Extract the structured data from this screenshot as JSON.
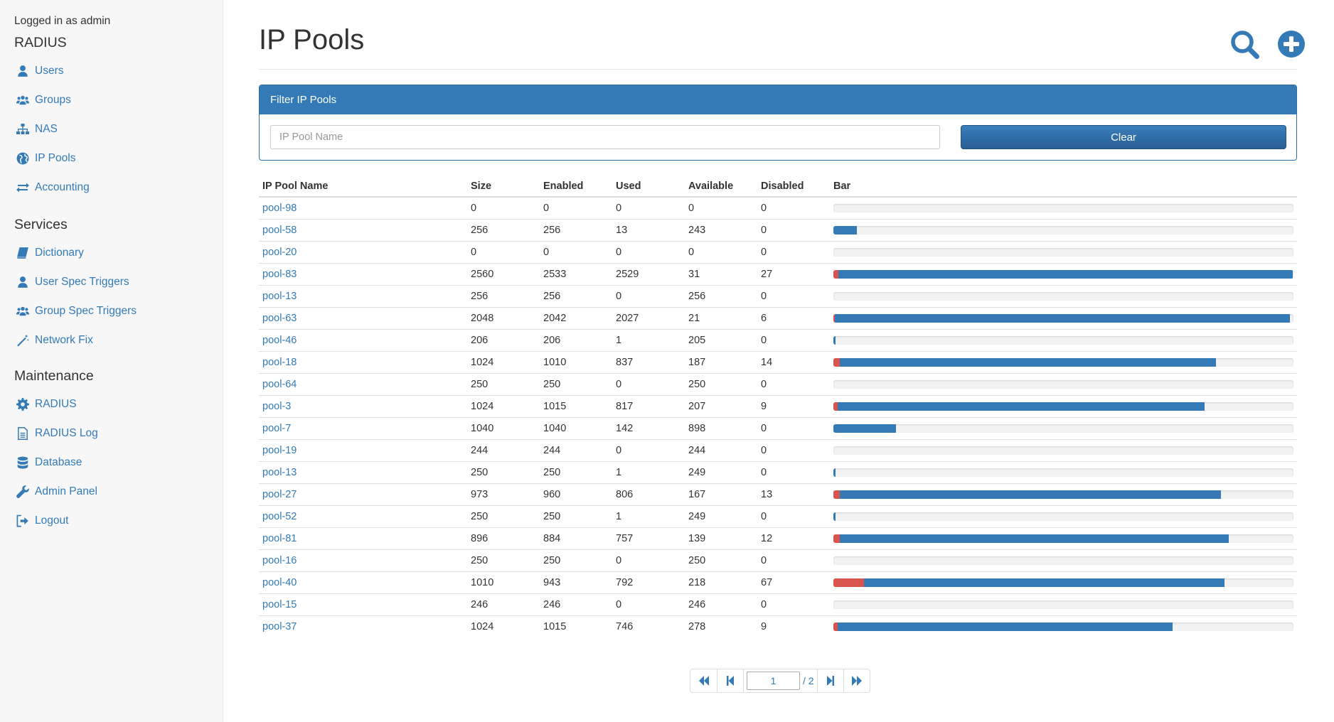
{
  "sidebar": {
    "logged_in": "Logged in as admin",
    "sections": [
      {
        "title": "RADIUS",
        "items": [
          {
            "label": "Users",
            "icon": "user-icon"
          },
          {
            "label": "Groups",
            "icon": "users-icon"
          },
          {
            "label": "NAS",
            "icon": "sitemap-icon"
          },
          {
            "label": "IP Pools",
            "icon": "globe-icon"
          },
          {
            "label": "Accounting",
            "icon": "exchange-icon"
          }
        ]
      },
      {
        "title": "Services",
        "items": [
          {
            "label": "Dictionary",
            "icon": "book-icon"
          },
          {
            "label": "User Spec Triggers",
            "icon": "user-icon"
          },
          {
            "label": "Group Spec Triggers",
            "icon": "users-icon"
          },
          {
            "label": "Network Fix",
            "icon": "magic-wand-icon"
          }
        ]
      },
      {
        "title": "Maintenance",
        "items": [
          {
            "label": "RADIUS",
            "icon": "gear-icon"
          },
          {
            "label": "RADIUS Log",
            "icon": "file-text-icon"
          },
          {
            "label": "Database",
            "icon": "database-icon"
          },
          {
            "label": "Admin Panel",
            "icon": "wrench-icon"
          },
          {
            "label": "Logout",
            "icon": "sign-out-icon"
          }
        ]
      }
    ]
  },
  "header": {
    "title": "IP Pools",
    "search_icon": "search-icon",
    "add_icon": "plus-circle-icon"
  },
  "filter": {
    "title": "Filter IP Pools",
    "placeholder": "IP Pool Name",
    "value": "",
    "clear_label": "Clear"
  },
  "table": {
    "columns": [
      "IP Pool Name",
      "Size",
      "Enabled",
      "Used",
      "Available",
      "Disabled",
      "Bar"
    ],
    "rows": [
      {
        "name": "pool-98",
        "size": "0",
        "enabled": "0",
        "used": "0",
        "available": "0",
        "disabled": "0"
      },
      {
        "name": "pool-58",
        "size": "256",
        "enabled": "256",
        "used": "13",
        "available": "243",
        "disabled": "0"
      },
      {
        "name": "pool-20",
        "size": "0",
        "enabled": "0",
        "used": "0",
        "available": "0",
        "disabled": "0"
      },
      {
        "name": "pool-83",
        "size": "2560",
        "enabled": "2533",
        "used": "2529",
        "available": "31",
        "disabled": "27"
      },
      {
        "name": "pool-13",
        "size": "256",
        "enabled": "256",
        "used": "0",
        "available": "256",
        "disabled": "0"
      },
      {
        "name": "pool-63",
        "size": "2048",
        "enabled": "2042",
        "used": "2027",
        "available": "21",
        "disabled": "6"
      },
      {
        "name": "pool-46",
        "size": "206",
        "enabled": "206",
        "used": "1",
        "available": "205",
        "disabled": "0"
      },
      {
        "name": "pool-18",
        "size": "1024",
        "enabled": "1010",
        "used": "837",
        "available": "187",
        "disabled": "14"
      },
      {
        "name": "pool-64",
        "size": "250",
        "enabled": "250",
        "used": "0",
        "available": "250",
        "disabled": "0"
      },
      {
        "name": "pool-3",
        "size": "1024",
        "enabled": "1015",
        "used": "817",
        "available": "207",
        "disabled": "9"
      },
      {
        "name": "pool-7",
        "size": "1040",
        "enabled": "1040",
        "used": "142",
        "available": "898",
        "disabled": "0"
      },
      {
        "name": "pool-19",
        "size": "244",
        "enabled": "244",
        "used": "0",
        "available": "244",
        "disabled": "0"
      },
      {
        "name": "pool-13",
        "size": "250",
        "enabled": "250",
        "used": "1",
        "available": "249",
        "disabled": "0"
      },
      {
        "name": "pool-27",
        "size": "973",
        "enabled": "960",
        "used": "806",
        "available": "167",
        "disabled": "13"
      },
      {
        "name": "pool-52",
        "size": "250",
        "enabled": "250",
        "used": "1",
        "available": "249",
        "disabled": "0"
      },
      {
        "name": "pool-81",
        "size": "896",
        "enabled": "884",
        "used": "757",
        "available": "139",
        "disabled": "12"
      },
      {
        "name": "pool-16",
        "size": "250",
        "enabled": "250",
        "used": "0",
        "available": "250",
        "disabled": "0"
      },
      {
        "name": "pool-40",
        "size": "1010",
        "enabled": "943",
        "used": "792",
        "available": "218",
        "disabled": "67"
      },
      {
        "name": "pool-15",
        "size": "246",
        "enabled": "246",
        "used": "0",
        "available": "246",
        "disabled": "0"
      },
      {
        "name": "pool-37",
        "size": "1024",
        "enabled": "1015",
        "used": "746",
        "available": "278",
        "disabled": "9"
      }
    ]
  },
  "pagination": {
    "current_page": "1",
    "total_pages": "/ 2"
  },
  "colors": {
    "accent": "#337ab7",
    "disabled_bar": "#d9534f",
    "track": "#f2f2f2"
  }
}
